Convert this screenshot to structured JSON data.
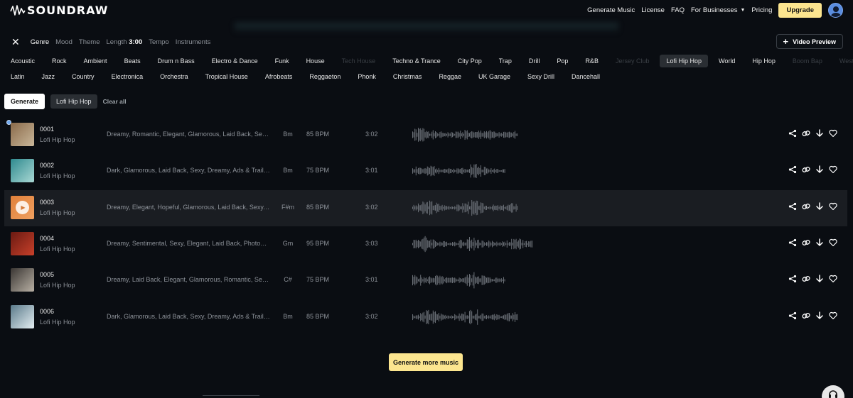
{
  "brand": {
    "name": "SOUNDRAW"
  },
  "nav": {
    "items": [
      "Generate Music",
      "License",
      "FAQ"
    ],
    "businesses": "For Businesses",
    "pricing": "Pricing",
    "upgrade": "Upgrade"
  },
  "filters": {
    "tabs": [
      "Genre",
      "Mood",
      "Theme"
    ],
    "length_label": "Length",
    "length_value": "3:00",
    "tempo": "Tempo",
    "instruments": "Instruments"
  },
  "video_preview": "Video Preview",
  "genres_row1": [
    {
      "label": "Acoustic",
      "state": "normal"
    },
    {
      "label": "Rock",
      "state": "normal"
    },
    {
      "label": "Ambient",
      "state": "normal"
    },
    {
      "label": "Beats",
      "state": "normal"
    },
    {
      "label": "Drum n Bass",
      "state": "normal"
    },
    {
      "label": "Electro & Dance",
      "state": "normal"
    },
    {
      "label": "Funk",
      "state": "normal"
    },
    {
      "label": "House",
      "state": "normal"
    },
    {
      "label": "Tech House",
      "state": "disabled"
    },
    {
      "label": "Techno & Trance",
      "state": "normal"
    },
    {
      "label": "City Pop",
      "state": "normal"
    },
    {
      "label": "Trap",
      "state": "normal"
    },
    {
      "label": "Drill",
      "state": "normal"
    },
    {
      "label": "Pop",
      "state": "normal"
    },
    {
      "label": "R&B",
      "state": "normal"
    },
    {
      "label": "Jersey Club",
      "state": "disabled"
    },
    {
      "label": "Lofi Hip Hop",
      "state": "selected"
    },
    {
      "label": "World",
      "state": "normal"
    },
    {
      "label": "Hip Hop",
      "state": "normal"
    },
    {
      "label": "Boom Bap",
      "state": "disabled"
    },
    {
      "label": "West Coast",
      "state": "disabled"
    }
  ],
  "genres_row2": [
    {
      "label": "Latin",
      "state": "normal"
    },
    {
      "label": "Jazz",
      "state": "normal"
    },
    {
      "label": "Country",
      "state": "normal"
    },
    {
      "label": "Electronica",
      "state": "normal"
    },
    {
      "label": "Orchestra",
      "state": "normal"
    },
    {
      "label": "Tropical House",
      "state": "normal"
    },
    {
      "label": "Afrobeats",
      "state": "normal"
    },
    {
      "label": "Reggaeton",
      "state": "normal"
    },
    {
      "label": "Phonk",
      "state": "normal"
    },
    {
      "label": "Christmas",
      "state": "normal"
    },
    {
      "label": "Reggae",
      "state": "normal"
    },
    {
      "label": "UK Garage",
      "state": "normal"
    },
    {
      "label": "Sexy Drill",
      "state": "normal"
    },
    {
      "label": "Dancehall",
      "state": "normal"
    }
  ],
  "generate": {
    "button": "Generate",
    "selected_filter": "Lofi Hip Hop",
    "clear": "Clear all",
    "more": "Generate more music"
  },
  "tracks": [
    {
      "id": "0001",
      "genre": "Lofi Hip Hop",
      "tags": "Dreamy, Romantic, Elegant, Glamorous, Laid Back, Sexy, Dreamy",
      "key": "Bm",
      "bpm": "85 BPM",
      "duration": "3:02",
      "thumb": [
        "#8a6a4a",
        "#c9b79a"
      ],
      "highlighted": false
    },
    {
      "id": "0002",
      "genre": "Lofi Hip Hop",
      "tags": "Dark, Glamorous, Laid Back, Sexy, Dreamy, Ads & Trailers",
      "key": "Bm",
      "bpm": "75 BPM",
      "duration": "3:01",
      "thumb": [
        "#2f8a8f",
        "#a9d8d4"
      ],
      "highlighted": false
    },
    {
      "id": "0003",
      "genre": "Lofi Hip Hop",
      "tags": "Dreamy, Elegant, Hopeful, Glamorous, Laid Back, Sexy, Dreamy",
      "key": "F#m",
      "bpm": "85 BPM",
      "duration": "3:02",
      "thumb": [
        "#e0803a",
        "#f0a060"
      ],
      "highlighted": true
    },
    {
      "id": "0004",
      "genre": "Lofi Hip Hop",
      "tags": "Dreamy, Sentimental, Sexy, Elegant, Laid Back, Photography",
      "key": "Gm",
      "bpm": "95 BPM",
      "duration": "3:03",
      "thumb": [
        "#6a1a12",
        "#c8402a"
      ],
      "highlighted": false
    },
    {
      "id": "0005",
      "genre": "Lofi Hip Hop",
      "tags": "Dreamy, Laid Back, Elegant, Glamorous, Romantic, Sexy, Dreamy",
      "key": "C#",
      "bpm": "75 BPM",
      "duration": "3:01",
      "thumb": [
        "#3a3633",
        "#b8b0a4"
      ],
      "highlighted": false
    },
    {
      "id": "0006",
      "genre": "Lofi Hip Hop",
      "tags": "Dark, Glamorous, Laid Back, Sexy, Dreamy, Ads & Trailers",
      "key": "Bm",
      "bpm": "85 BPM",
      "duration": "3:02",
      "thumb": [
        "#5a7a8a",
        "#e4eef2"
      ],
      "highlighted": false
    }
  ],
  "icons": {
    "share": "share-icon",
    "link": "link-icon",
    "download": "download-icon",
    "favorite": "heart-icon",
    "help": "headphones-icon"
  },
  "colors": {
    "accent": "#fce58f",
    "background": "#0a0d12",
    "avatar": "#5a8de0"
  }
}
